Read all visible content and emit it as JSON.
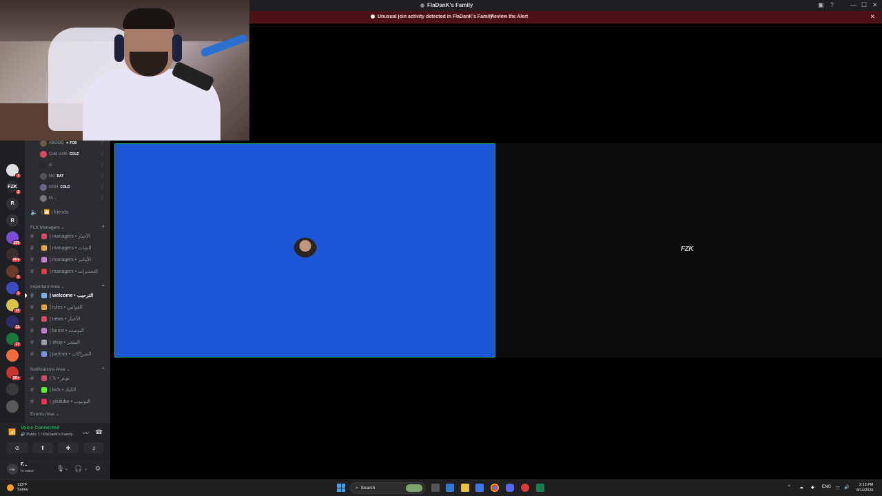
{
  "window": {
    "title": "FlaDanK's Family",
    "minimize": "—",
    "maximize": "☐",
    "close": "✕"
  },
  "alert": {
    "message": "Unusual join activity detected in FlaDanK's Family",
    "link": "Review the Alert",
    "close": "✕"
  },
  "servers": [
    {
      "label": "",
      "color": "#1e1f22",
      "badge": ""
    },
    {
      "label": "",
      "color": "#e0e0e0",
      "badge": "1"
    },
    {
      "label": "FZK",
      "color": "#2b2d31",
      "badge": "2"
    },
    {
      "label": "R",
      "color": "#313338",
      "badge": ""
    },
    {
      "label": "R",
      "color": "#313338",
      "badge": ""
    },
    {
      "label": "",
      "color": "#7a4fd6",
      "badge": "109"
    },
    {
      "label": "",
      "color": "#3a2e2e",
      "badge": "4K+"
    },
    {
      "label": "",
      "color": "#6b3a2a",
      "badge": "2"
    },
    {
      "label": "",
      "color": "#3b4cc0",
      "badge": "3"
    },
    {
      "label": "",
      "color": "#d8c24a",
      "badge": "36"
    },
    {
      "label": "",
      "color": "#2d2d6b",
      "badge": "11"
    },
    {
      "label": "",
      "color": "#1a7a3c",
      "badge": "17"
    },
    {
      "label": "",
      "color": "#f26b3a",
      "badge": ""
    },
    {
      "label": "",
      "color": "#c9352c",
      "badge": "5K+"
    },
    {
      "label": "",
      "color": "#3a3a3a",
      "badge": ""
    },
    {
      "label": "",
      "color": "#5a5a5a",
      "badge": ""
    }
  ],
  "voice_users": [
    {
      "name": "ABOOD",
      "tag": "✦ FCB"
    },
    {
      "name": "Cold sloth",
      "tag": "COLD"
    },
    {
      "name": "G",
      "tag": ""
    },
    {
      "name": "Mo",
      "tag": "BAT"
    },
    {
      "name": "MSH",
      "tag": "COLD"
    },
    {
      "name": "M...",
      "tag": ""
    }
  ],
  "voice_channel": {
    "label": "| 🎦 | friends"
  },
  "categories": [
    {
      "name": "FLK Managers ⌄",
      "channels": [
        {
          "label": "| managers • الأخبار",
          "emo": "#d94a6a",
          "active": false
        },
        {
          "label": "| managers • الشات",
          "emo": "#e8a33c",
          "active": false
        },
        {
          "label": "| managers • الأوامر",
          "emo": "#c97bd4",
          "active": false
        },
        {
          "label": "| managers • التحذيرات",
          "emo": "#e23c4a",
          "active": false
        }
      ]
    },
    {
      "name": "Important Area ⌄",
      "channels": [
        {
          "label": "| welcome • الترحيب",
          "emo": "#7ab6e8",
          "active": true
        },
        {
          "label": "| rules • القوانين",
          "emo": "#e8a33c",
          "active": false
        },
        {
          "label": "| news • الأخبار",
          "emo": "#d94a6a",
          "active": false
        },
        {
          "label": "| boost • البوست",
          "emo": "#c97bd4",
          "active": false
        },
        {
          "label": "| shop • المتجر",
          "emo": "#9aa0a6",
          "active": false
        },
        {
          "label": "| partner • الشراكات",
          "emo": "#7a8fe8",
          "active": false
        }
      ]
    },
    {
      "name": "Notifications Area ⌄",
      "channels": [
        {
          "label": "| 𝕏 • تويتر",
          "emo": "#d94a6a",
          "active": false
        },
        {
          "label": "| kick • الكيك",
          "emo": "#53fc18",
          "active": false
        },
        {
          "label": "| youtube • اليوتيوب",
          "emo": "#ff2d55",
          "active": false
        }
      ]
    }
  ],
  "next_category": "Events Area ⌄",
  "voice_panel": {
    "status": "Voice Connected",
    "location": "Public 1 / FlaDanK's Family"
  },
  "user": {
    "name": "F...",
    "status": "In voice",
    "avatar_text": "FZK"
  },
  "stage": {
    "logo_text": "FZK"
  },
  "taskbar": {
    "temp": "113°F",
    "weather": "Sunny",
    "search_placeholder": "Search",
    "lang": "ENG",
    "time": "2:13 PM",
    "date": "8/14/2026"
  }
}
